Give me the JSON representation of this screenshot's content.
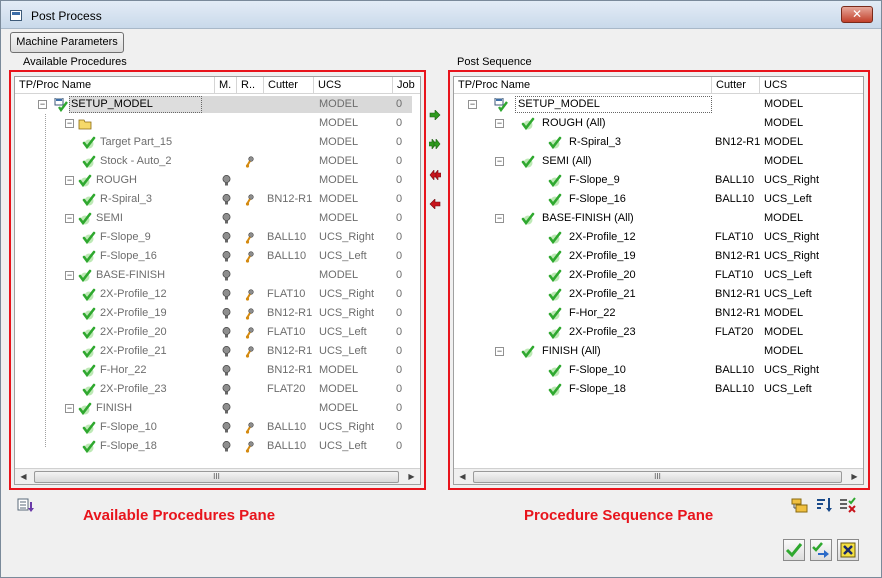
{
  "window": {
    "title": "Post Process",
    "close_label": "✕"
  },
  "toolbar": {
    "machine_parameters_label": "Machine Parameters"
  },
  "left_pane": {
    "label": "Available Procedures",
    "columns": [
      "TP/Proc Name",
      "M.",
      "R..",
      "Cutter",
      "UCS",
      "Job"
    ],
    "rows": [
      {
        "name": "SETUP_MODEL",
        "ucs": "MODEL",
        "job": "0",
        "kind": "setup",
        "cutter": "",
        "m": false,
        "r": false
      },
      {
        "name": "",
        "ucs": "MODEL",
        "job": "0",
        "kind": "folder",
        "cutter": "",
        "m": false,
        "r": false
      },
      {
        "name": "Target Part_15",
        "ucs": "MODEL",
        "job": "0",
        "kind": "item",
        "cutter": "",
        "m": false,
        "r": false
      },
      {
        "name": "Stock - Auto_2",
        "ucs": "MODEL",
        "job": "0",
        "kind": "item",
        "cutter": "",
        "m": false,
        "r": true
      },
      {
        "name": "ROUGH",
        "ucs": "MODEL",
        "job": "0",
        "kind": "group",
        "cutter": "",
        "m": true,
        "r": false
      },
      {
        "name": "R-Spiral_3",
        "ucs": "MODEL",
        "job": "0",
        "kind": "item",
        "cutter": "BN12-R1",
        "m": true,
        "r": true
      },
      {
        "name": "SEMI",
        "ucs": "MODEL",
        "job": "0",
        "kind": "group",
        "cutter": "",
        "m": true,
        "r": false
      },
      {
        "name": "F-Slope_9",
        "ucs": "UCS_Right",
        "job": "0",
        "kind": "item",
        "cutter": "BALL10",
        "m": true,
        "r": true
      },
      {
        "name": "F-Slope_16",
        "ucs": "UCS_Left",
        "job": "0",
        "kind": "item",
        "cutter": "BALL10",
        "m": true,
        "r": true
      },
      {
        "name": "BASE-FINISH",
        "ucs": "MODEL",
        "job": "0",
        "kind": "group",
        "cutter": "",
        "m": true,
        "r": false
      },
      {
        "name": "2X-Profile_12",
        "ucs": "UCS_Right",
        "job": "0",
        "kind": "item",
        "cutter": "FLAT10",
        "m": true,
        "r": true
      },
      {
        "name": "2X-Profile_19",
        "ucs": "UCS_Right",
        "job": "0",
        "kind": "item",
        "cutter": "BN12-R1",
        "m": true,
        "r": true
      },
      {
        "name": "2X-Profile_20",
        "ucs": "UCS_Left",
        "job": "0",
        "kind": "item",
        "cutter": "FLAT10",
        "m": true,
        "r": true
      },
      {
        "name": "2X-Profile_21",
        "ucs": "UCS_Left",
        "job": "0",
        "kind": "item",
        "cutter": "BN12-R1",
        "m": true,
        "r": true
      },
      {
        "name": "F-Hor_22",
        "ucs": "MODEL",
        "job": "0",
        "kind": "item",
        "cutter": "BN12-R1",
        "m": true,
        "r": false
      },
      {
        "name": "2X-Profile_23",
        "ucs": "MODEL",
        "job": "0",
        "kind": "item",
        "cutter": "FLAT20",
        "m": true,
        "r": false
      },
      {
        "name": "FINISH",
        "ucs": "MODEL",
        "job": "0",
        "kind": "group",
        "cutter": "",
        "m": true,
        "r": false
      },
      {
        "name": "F-Slope_10",
        "ucs": "UCS_Right",
        "job": "0",
        "kind": "item",
        "cutter": "BALL10",
        "m": true,
        "r": true
      },
      {
        "name": "F-Slope_18",
        "ucs": "UCS_Left",
        "job": "0",
        "kind": "item",
        "cutter": "BALL10",
        "m": true,
        "r": true
      }
    ]
  },
  "right_pane": {
    "label": "Post Sequence",
    "columns": [
      "TP/Proc Name",
      "Cutter",
      "UCS"
    ],
    "rows": [
      {
        "name": "SETUP_MODEL",
        "cutter": "",
        "ucs": "MODEL",
        "kind": "setup"
      },
      {
        "name": "ROUGH (All)",
        "cutter": "",
        "ucs": "MODEL",
        "kind": "group"
      },
      {
        "name": "R-Spiral_3",
        "cutter": "BN12-R1",
        "ucs": "MODEL",
        "kind": "item"
      },
      {
        "name": "SEMI (All)",
        "cutter": "",
        "ucs": "MODEL",
        "kind": "group"
      },
      {
        "name": "F-Slope_9",
        "cutter": "BALL10",
        "ucs": "UCS_Right",
        "kind": "item"
      },
      {
        "name": "F-Slope_16",
        "cutter": "BALL10",
        "ucs": "UCS_Left",
        "kind": "item"
      },
      {
        "name": "BASE-FINISH (All)",
        "cutter": "",
        "ucs": "MODEL",
        "kind": "group"
      },
      {
        "name": "2X-Profile_12",
        "cutter": "FLAT10",
        "ucs": "UCS_Right",
        "kind": "item"
      },
      {
        "name": "2X-Profile_19",
        "cutter": "BN12-R1",
        "ucs": "UCS_Right",
        "kind": "item"
      },
      {
        "name": "2X-Profile_20",
        "cutter": "FLAT10",
        "ucs": "UCS_Left",
        "kind": "item"
      },
      {
        "name": "2X-Profile_21",
        "cutter": "BN12-R1",
        "ucs": "UCS_Left",
        "kind": "item"
      },
      {
        "name": "F-Hor_22",
        "cutter": "BN12-R1",
        "ucs": "MODEL",
        "kind": "item"
      },
      {
        "name": "2X-Profile_23",
        "cutter": "FLAT20",
        "ucs": "MODEL",
        "kind": "item"
      },
      {
        "name": "FINISH (All)",
        "cutter": "",
        "ucs": "MODEL",
        "kind": "group"
      },
      {
        "name": "F-Slope_10",
        "cutter": "BALL10",
        "ucs": "UCS_Right",
        "kind": "item"
      },
      {
        "name": "F-Slope_18",
        "cutter": "BALL10",
        "ucs": "UCS_Left",
        "kind": "item"
      }
    ]
  },
  "annotations": {
    "left": "Available Procedures Pane",
    "right": "Procedure Sequence Pane"
  },
  "scroll_thumb_glyph": "III",
  "colors": {
    "annotation_red": "#e8141c",
    "check_green": "#2fa82f",
    "arrow_green": "#2e9a1e",
    "arrow_red": "#c8141c"
  }
}
